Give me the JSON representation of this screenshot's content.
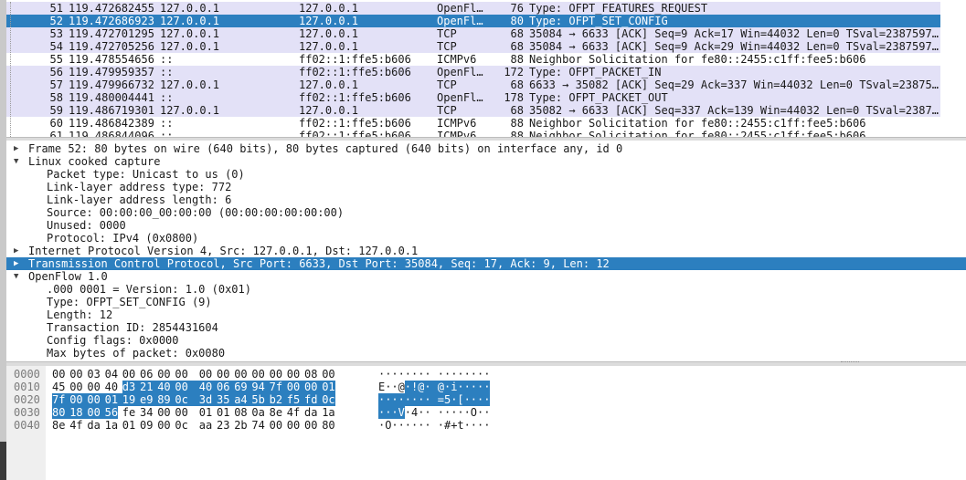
{
  "colors": {
    "row_bg": "#e3e1f7",
    "selection": "#2c7fbf",
    "selected_text": "#ffffff"
  },
  "packets": [
    {
      "no": "51",
      "time": "119.472682455",
      "src": "127.0.0.1",
      "dst": "127.0.0.1",
      "proto": "OpenFl…",
      "len": "76",
      "info": "Type: OFPT_FEATURES_REQUEST"
    },
    {
      "no": "52",
      "time": "119.472686923",
      "src": "127.0.0.1",
      "dst": "127.0.0.1",
      "proto": "OpenFl…",
      "len": "80",
      "info": "Type: OFPT_SET_CONFIG"
    },
    {
      "no": "53",
      "time": "119.472701295",
      "src": "127.0.0.1",
      "dst": "127.0.0.1",
      "proto": "TCP",
      "len": "68",
      "info": "35084 → 6633 [ACK] Seq=9 Ack=17 Win=44032 Len=0 TSval=2387597…"
    },
    {
      "no": "54",
      "time": "119.472705256",
      "src": "127.0.0.1",
      "dst": "127.0.0.1",
      "proto": "TCP",
      "len": "68",
      "info": "35084 → 6633 [ACK] Seq=9 Ack=29 Win=44032 Len=0 TSval=2387597…"
    },
    {
      "no": "55",
      "time": "119.478554656",
      "src": "::",
      "dst": "ff02::1:ffe5:b606",
      "proto": "ICMPv6",
      "len": "88",
      "info": "Neighbor Solicitation for fe80::2455:c1ff:fee5:b606"
    },
    {
      "no": "56",
      "time": "119.479959357",
      "src": "::",
      "dst": "ff02::1:ffe5:b606",
      "proto": "OpenFl…",
      "len": "172",
      "info": "Type: OFPT_PACKET_IN"
    },
    {
      "no": "57",
      "time": "119.479966732",
      "src": "127.0.0.1",
      "dst": "127.0.0.1",
      "proto": "TCP",
      "len": "68",
      "info": "6633 → 35082 [ACK] Seq=29 Ack=337 Win=44032 Len=0 TSval=23875…"
    },
    {
      "no": "58",
      "time": "119.480004441",
      "src": "::",
      "dst": "ff02::1:ffe5:b606",
      "proto": "OpenFl…",
      "len": "178",
      "info": "Type: OFPT_PACKET_OUT"
    },
    {
      "no": "59",
      "time": "119.486719301",
      "src": "127.0.0.1",
      "dst": "127.0.0.1",
      "proto": "TCP",
      "len": "68",
      "info": "35082 → 6633 [ACK] Seq=337 Ack=139 Win=44032 Len=0 TSval=2387…"
    },
    {
      "no": "60",
      "time": "119.486842389",
      "src": "::",
      "dst": "ff02::1:ffe5:b606",
      "proto": "ICMPv6",
      "len": "88",
      "info": "Neighbor Solicitation for fe80::2455:c1ff:fee5:b606"
    },
    {
      "no": "61",
      "time": "119.486844096",
      "src": "::",
      "dst": "ff02::1:ffe5:b606",
      "proto": "ICMPv6",
      "len": "88",
      "info": "Neighbor Solicitation for fe80::2455:c1ff:fee5:b606"
    }
  ],
  "details": {
    "frame": "Frame 52: 80 bytes on wire (640 bits), 80 bytes captured (640 bits) on interface any, id 0",
    "sll": "Linux cooked capture",
    "sll_fields": [
      "Packet type: Unicast to us (0)",
      "Link-layer address type: 772",
      "Link-layer address length: 6",
      "Source: 00:00:00_00:00:00 (00:00:00:00:00:00)",
      "Unused: 0000",
      "Protocol: IPv4 (0x0800)"
    ],
    "ip": "Internet Protocol Version 4, Src: 127.0.0.1, Dst: 127.0.0.1",
    "tcp": "Transmission Control Protocol, Src Port: 6633, Dst Port: 35084, Seq: 17, Ack: 9, Len: 12",
    "of": "OpenFlow 1.0",
    "of_fields": [
      ".000 0001 = Version: 1.0 (0x01)",
      "Type: OFPT_SET_CONFIG (9)",
      "Length: 12",
      "Transaction ID: 2854431604",
      "Config flags: 0x0000",
      "Max bytes of packet: 0x0080"
    ]
  },
  "bytes": {
    "offsets": [
      "0000",
      "0010",
      "0020",
      "0030",
      "0040"
    ],
    "hex": [
      [
        "00",
        "00",
        "03",
        "04",
        "00",
        "06",
        "00",
        "00",
        "00",
        "00",
        "00",
        "00",
        "00",
        "00",
        "08",
        "00"
      ],
      [
        "45",
        "00",
        "00",
        "40",
        "d3",
        "21",
        "40",
        "00",
        "40",
        "06",
        "69",
        "94",
        "7f",
        "00",
        "00",
        "01"
      ],
      [
        "7f",
        "00",
        "00",
        "01",
        "19",
        "e9",
        "89",
        "0c",
        "3d",
        "35",
        "a4",
        "5b",
        "b2",
        "f5",
        "fd",
        "0c"
      ],
      [
        "80",
        "18",
        "00",
        "56",
        "fe",
        "34",
        "00",
        "00",
        "01",
        "01",
        "08",
        "0a",
        "8e",
        "4f",
        "da",
        "1a"
      ],
      [
        "8e",
        "4f",
        "da",
        "1a",
        "01",
        "09",
        "00",
        "0c",
        "aa",
        "23",
        "2b",
        "74",
        "00",
        "00",
        "00",
        "80"
      ]
    ],
    "ascii": [
      [
        "·",
        "·",
        "·",
        "·",
        "·",
        "·",
        "·",
        "·",
        "·",
        "·",
        "·",
        "·",
        "·",
        "·",
        "·",
        "·"
      ],
      [
        "E",
        "·",
        "·",
        "@",
        "·",
        "!",
        "@",
        "·",
        "@",
        "·",
        "i",
        "·",
        "·",
        "·",
        "·",
        "·"
      ],
      [
        "·",
        "·",
        "·",
        "·",
        "·",
        "·",
        "·",
        "·",
        "=",
        "5",
        "·",
        "[",
        "·",
        "·",
        "·",
        "·"
      ],
      [
        "·",
        "·",
        "·",
        "V",
        "·",
        "4",
        "·",
        "·",
        "·",
        "·",
        "·",
        "·",
        "·",
        "O",
        "·",
        "·"
      ],
      [
        "·",
        "O",
        "·",
        "·",
        "·",
        "·",
        "·",
        "·",
        "·",
        "#",
        "+",
        "t",
        "·",
        "·",
        "·",
        "·"
      ]
    ]
  }
}
